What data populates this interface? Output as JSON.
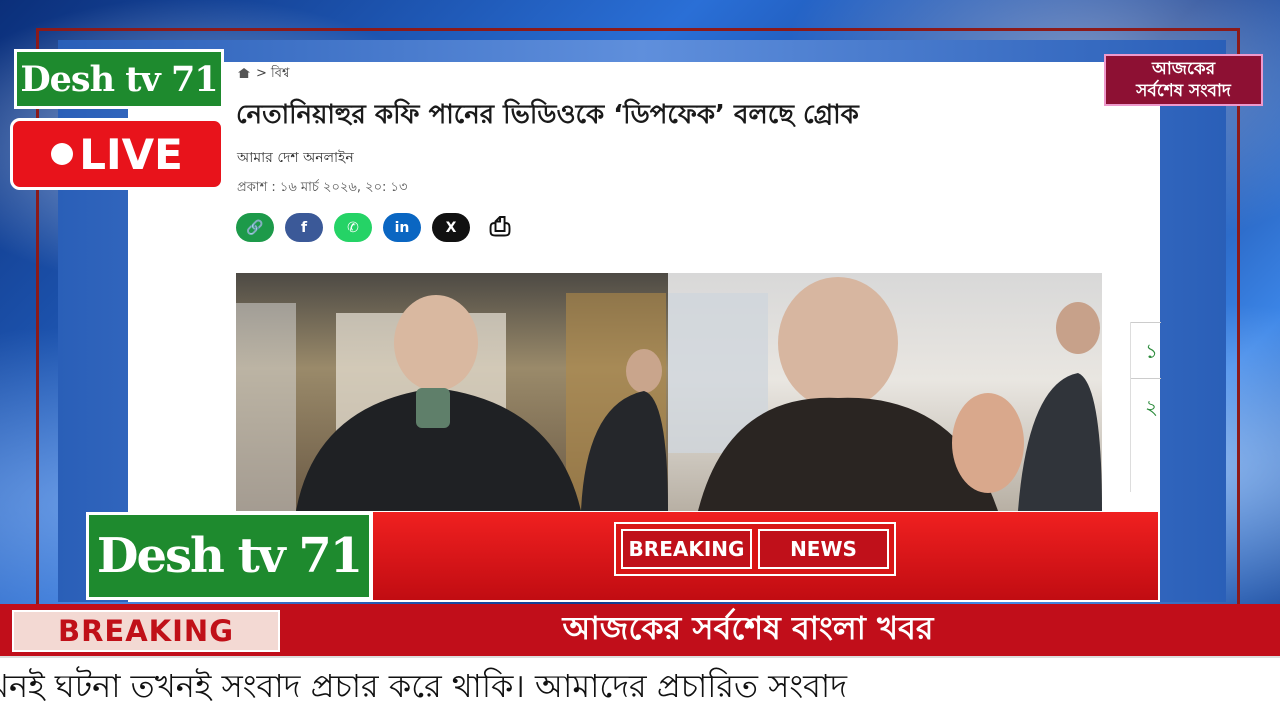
{
  "channel": {
    "logo_top": "Desh tv 71",
    "logo_bottom": "Desh tv 71",
    "live_label": "LIVE",
    "top_right_badge_line1": "আজকের",
    "top_right_badge_line2": "সর্বশেষ সংবাদ"
  },
  "article": {
    "breadcrumb": "> বিশ্ব",
    "headline": "নেতানিয়াহুর কফি পানের ভিডিওকে ‘ডিপফেক’ বলছে গ্রোক",
    "author": "আমার দেশ অনলাইন",
    "published": "প্রকাশ : ১৬ মার্চ ২০২৬, ২০: ১৩",
    "share_icons": [
      "link-icon",
      "facebook-icon",
      "whatsapp-icon",
      "linkedin-icon",
      "x-icon",
      "print-icon"
    ],
    "share_labels": [
      "🔗",
      "f",
      "✆",
      "in",
      "X",
      "⎙"
    ],
    "side_numbers": [
      "১",
      "২"
    ]
  },
  "breaking_banner": {
    "word1": "BREAKING",
    "word2": "NEWS"
  },
  "lower_third": {
    "label": "BREAKING",
    "title": "আজকের সর্বশেষ বাংলা খবর",
    "ticker": "খনই ঘটনা তখনই সংবাদ প্রচার করে থাকি। আমাদের প্রচারিত সংবাদ"
  },
  "colors": {
    "green": "#1e8a2e",
    "red": "#c10e1a",
    "live_red": "#e8131b"
  }
}
